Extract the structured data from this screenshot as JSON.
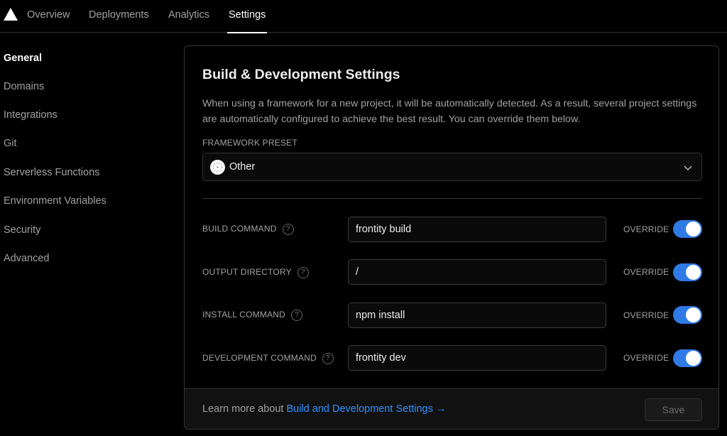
{
  "nav": {
    "tabs": [
      {
        "label": "Overview"
      },
      {
        "label": "Deployments"
      },
      {
        "label": "Analytics"
      },
      {
        "label": "Settings"
      }
    ],
    "active": "Settings"
  },
  "sidebar": {
    "items": [
      {
        "label": "General"
      },
      {
        "label": "Domains"
      },
      {
        "label": "Integrations"
      },
      {
        "label": "Git"
      },
      {
        "label": "Serverless Functions"
      },
      {
        "label": "Environment Variables"
      },
      {
        "label": "Security"
      },
      {
        "label": "Advanced"
      }
    ],
    "active": "General"
  },
  "card": {
    "title": "Build & Development Settings",
    "description": "When using a framework for a new project, it will be automatically detected. As a result, several project settings are automatically configured to achieve the best result. You can override them below.",
    "framework_label": "FRAMEWORK PRESET",
    "framework_value": "Other",
    "override_label": "OVERRIDE",
    "help_glyph": "?",
    "rows": [
      {
        "label": "BUILD COMMAND",
        "value": "frontity build",
        "override": true
      },
      {
        "label": "OUTPUT DIRECTORY",
        "value": "/",
        "override": true
      },
      {
        "label": "INSTALL COMMAND",
        "value": "npm install",
        "override": true
      },
      {
        "label": "DEVELOPMENT COMMAND",
        "value": "frontity dev",
        "override": true
      }
    ],
    "footer": {
      "text": "Learn more about",
      "link": "Build and Development Settings →",
      "save": "Save"
    }
  },
  "colors": {
    "accent": "#2f7ae5",
    "link": "#3291ff",
    "background": "#000000"
  },
  "icons": {
    "logo": "triangle-logo-icon",
    "preset": "framework-other-icon",
    "dropdown": "chevron-down-icon",
    "help": "help-circle-icon"
  }
}
